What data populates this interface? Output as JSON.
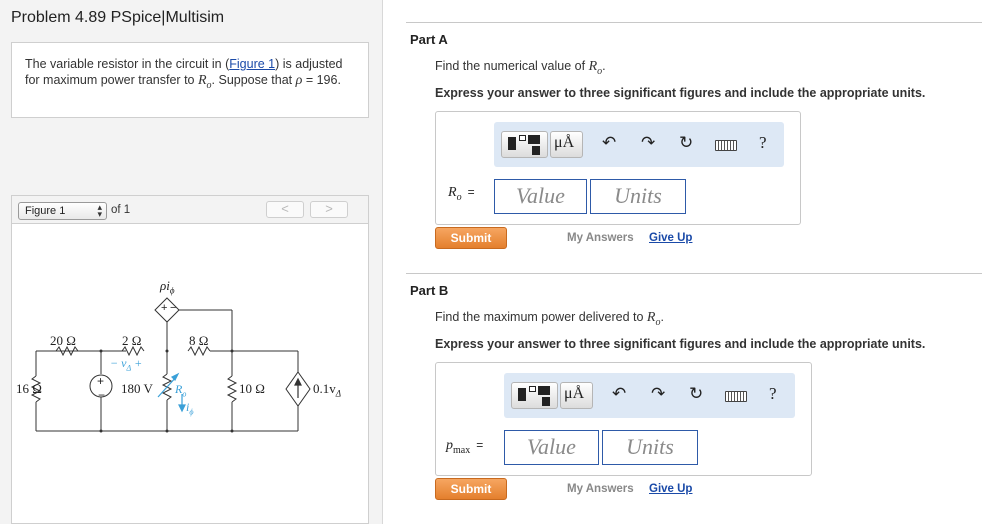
{
  "problem": {
    "title": "Problem 4.89 PSpice|Multisim",
    "text_before_link": "The variable resistor in the circuit in (",
    "figure_link": "Figure 1",
    "text_after_link": ") is adjusted for maximum power transfer to ",
    "target_var": "R",
    "target_sub": "o",
    "text_suppose": ". Suppose that ",
    "rho_symbol": "ρ",
    "rho_value": " = 196."
  },
  "figure": {
    "selector_value": "Figure 1",
    "of_label": "of 1",
    "prev_glyph": "<",
    "next_glyph": ">"
  },
  "circuit": {
    "dep_source_label": "ρi",
    "dep_source_sub": "ϕ",
    "r1": "20 Ω",
    "r2": "2 Ω",
    "r3": "8 Ω",
    "r_left": "16 Ω",
    "v_source": "180 V",
    "v_delta": "v",
    "v_delta_sub": "Δ",
    "ro_label": "R",
    "ro_sub": "o",
    "i_phi": "i",
    "i_phi_sub": "ϕ",
    "r_right": "10 Ω",
    "current_source": "0.1v",
    "current_source_sub": "Δ",
    "plus": "+",
    "minus": "−"
  },
  "partA": {
    "title": "Part A",
    "prompt_pre": "Find the numerical value of ",
    "prompt_var": "R",
    "prompt_sub": "o",
    "prompt_post": ".",
    "express": "Express your answer to three significant figures and include the appropriate units.",
    "var_label": "R",
    "var_sub": "o",
    "eq": "=",
    "value_placeholder": "Value",
    "units_placeholder": "Units",
    "submit": "Submit",
    "my_answers": "My Answers",
    "give_up": "Give Up"
  },
  "partB": {
    "title": "Part B",
    "prompt_pre": "Find the maximum power delivered to ",
    "prompt_var": "R",
    "prompt_sub": "o",
    "prompt_post": ".",
    "express": "Express your answer to three significant figures and include the appropriate units.",
    "var_label": "p",
    "var_sub": "max",
    "eq": "=",
    "value_placeholder": "Value",
    "units_placeholder": "Units",
    "submit": "Submit",
    "my_answers": "My Answers",
    "give_up": "Give Up"
  },
  "toolbar": {
    "units_label": "μÅ",
    "help_label": "?",
    "icons": [
      "templates-icon",
      "units-icon",
      "undo-icon",
      "redo-icon",
      "reset-icon",
      "keyboard-icon",
      "help-icon"
    ]
  }
}
